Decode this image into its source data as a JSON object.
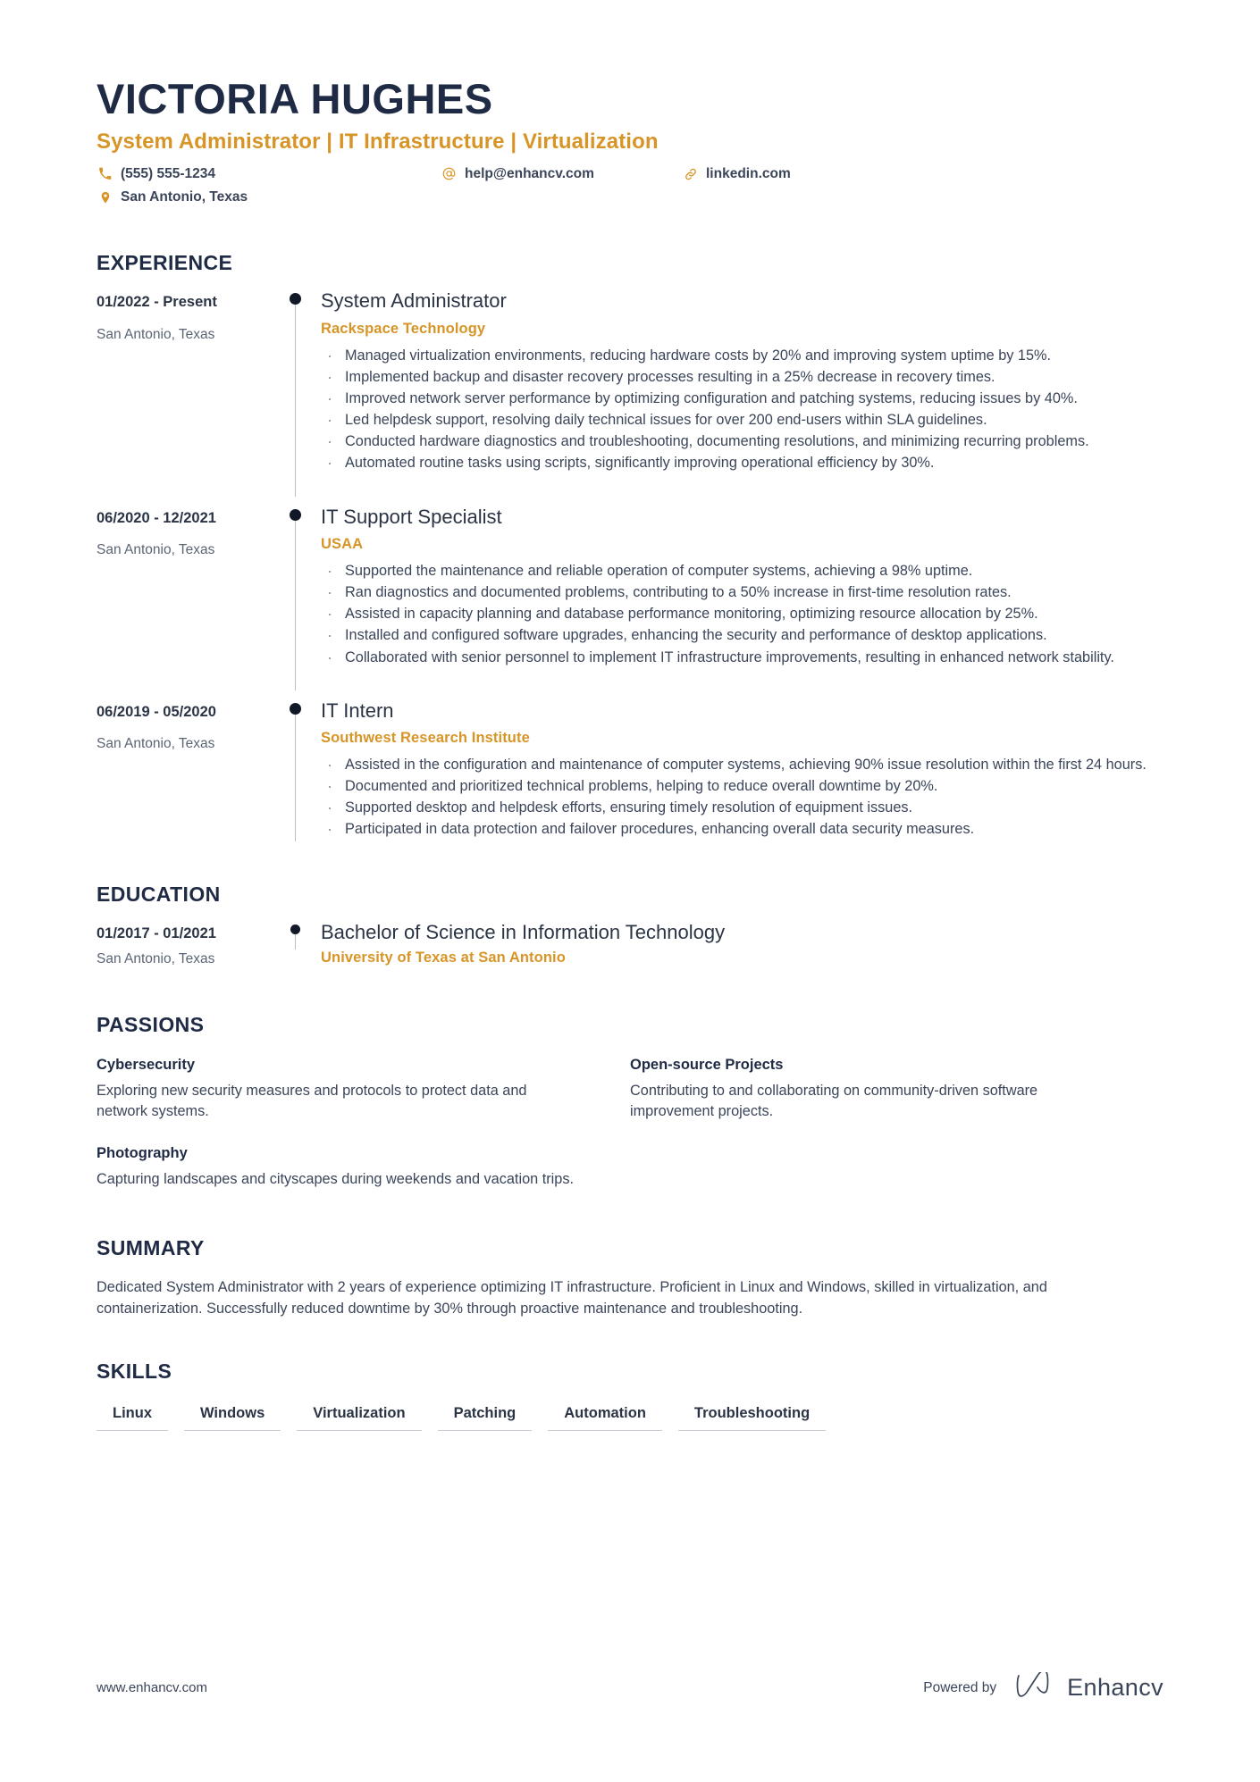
{
  "header": {
    "name": "VICTORIA HUGHES",
    "headline": "System Administrator | IT Infrastructure | Virtualization",
    "phone": "(555) 555-1234",
    "email": "help@enhancv.com",
    "website": "linkedin.com",
    "location": "San Antonio, Texas"
  },
  "sections": {
    "experience_title": "EXPERIENCE",
    "education_title": "EDUCATION",
    "passions_title": "PASSIONS",
    "summary_title": "SUMMARY",
    "skills_title": "SKILLS"
  },
  "experience": [
    {
      "date": "01/2022 - Present",
      "location": "San Antonio, Texas",
      "title": "System Administrator",
      "organization": "Rackspace Technology",
      "bullets": [
        "Managed virtualization environments, reducing hardware costs by 20% and improving system uptime by 15%.",
        "Implemented backup and disaster recovery processes resulting in a 25% decrease in recovery times.",
        "Improved network server performance by optimizing configuration and patching systems, reducing issues by 40%.",
        "Led helpdesk support, resolving daily technical issues for over 200 end-users within SLA guidelines.",
        "Conducted hardware diagnostics and troubleshooting, documenting resolutions, and minimizing recurring problems.",
        "Automated routine tasks using scripts, significantly improving operational efficiency by 30%."
      ]
    },
    {
      "date": "06/2020 - 12/2021",
      "location": "San Antonio, Texas",
      "title": "IT Support Specialist",
      "organization": "USAA",
      "bullets": [
        "Supported the maintenance and reliable operation of computer systems, achieving a 98% uptime.",
        "Ran diagnostics and documented problems, contributing to a 50% increase in first-time resolution rates.",
        "Assisted in capacity planning and database performance monitoring, optimizing resource allocation by 25%.",
        "Installed and configured software upgrades, enhancing the security and performance of desktop applications.",
        "Collaborated with senior personnel to implement IT infrastructure improvements, resulting in enhanced network stability."
      ]
    },
    {
      "date": "06/2019 - 05/2020",
      "location": "San Antonio, Texas",
      "title": "IT Intern",
      "organization": "Southwest Research Institute",
      "bullets": [
        "Assisted in the configuration and maintenance of computer systems, achieving 90% issue resolution within the first 24 hours.",
        "Documented and prioritized technical problems, helping to reduce overall downtime by 20%.",
        "Supported desktop and helpdesk efforts, ensuring timely resolution of equipment issues.",
        "Participated in data protection and failover procedures, enhancing overall data security measures."
      ]
    }
  ],
  "education": [
    {
      "date": "01/2017 - 01/2021",
      "location": "San Antonio, Texas",
      "degree": "Bachelor of Science in Information Technology",
      "school": "University of Texas at San Antonio"
    }
  ],
  "passions": [
    {
      "title": "Cybersecurity",
      "description": "Exploring new security measures and protocols to protect data and network systems."
    },
    {
      "title": "Open-source Projects",
      "description": "Contributing to and collaborating on community-driven software improvement projects."
    },
    {
      "title": "Photography",
      "description": "Capturing landscapes and cityscapes during weekends and vacation trips."
    }
  ],
  "summary": "Dedicated System Administrator with 2 years of experience optimizing IT infrastructure. Proficient in Linux and Windows, skilled in virtualization, and containerization. Successfully reduced downtime by 30% through proactive maintenance and troubleshooting.",
  "skills": [
    "Linux",
    "Windows",
    "Virtualization",
    "Patching",
    "Automation",
    "Troubleshooting"
  ],
  "footer": {
    "url": "www.enhancv.com",
    "powered_by": "Powered by",
    "brand": "Enhancv"
  },
  "colors": {
    "accent": "#d79527",
    "heading": "#1f2a44",
    "body": "#3b4559"
  }
}
